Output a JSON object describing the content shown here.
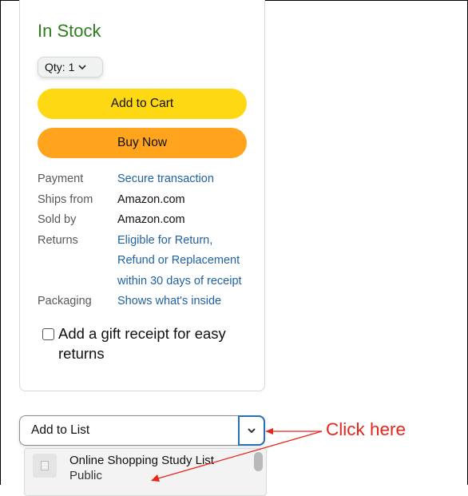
{
  "stock_status": "In Stock",
  "quantity": {
    "label": "Qty:",
    "value": "1"
  },
  "buttons": {
    "add_to_cart": "Add to Cart",
    "buy_now": "Buy Now"
  },
  "details": [
    {
      "key": "Payment",
      "value": "Secure transaction",
      "link": true
    },
    {
      "key": "Ships from",
      "value": "Amazon.com",
      "link": false
    },
    {
      "key": "Sold by",
      "value": "Amazon.com",
      "link": false
    },
    {
      "key": "Returns",
      "value": "Eligible for Return,",
      "link": true
    },
    {
      "key": "",
      "value": "Refund or Replacement",
      "link": true
    },
    {
      "key": "",
      "value": "within 30 days of receipt",
      "link": true
    },
    {
      "key": "Packaging",
      "value": "Shows what's inside",
      "link": true
    }
  ],
  "gift_receipt": {
    "line1": "Add a gift receipt for easy",
    "line2": "returns"
  },
  "add_to_list": {
    "label": "Add to List"
  },
  "list_options": [
    {
      "name": "Online Shopping Study List",
      "privacy": "Public"
    }
  ],
  "annotation": {
    "text": "Click here",
    "color": "#e8251c"
  },
  "colors": {
    "stock_green": "#2e7d1e",
    "cart_yellow": "#ffd814",
    "buy_orange": "#ffa41c",
    "link_blue": "#2162a1"
  }
}
